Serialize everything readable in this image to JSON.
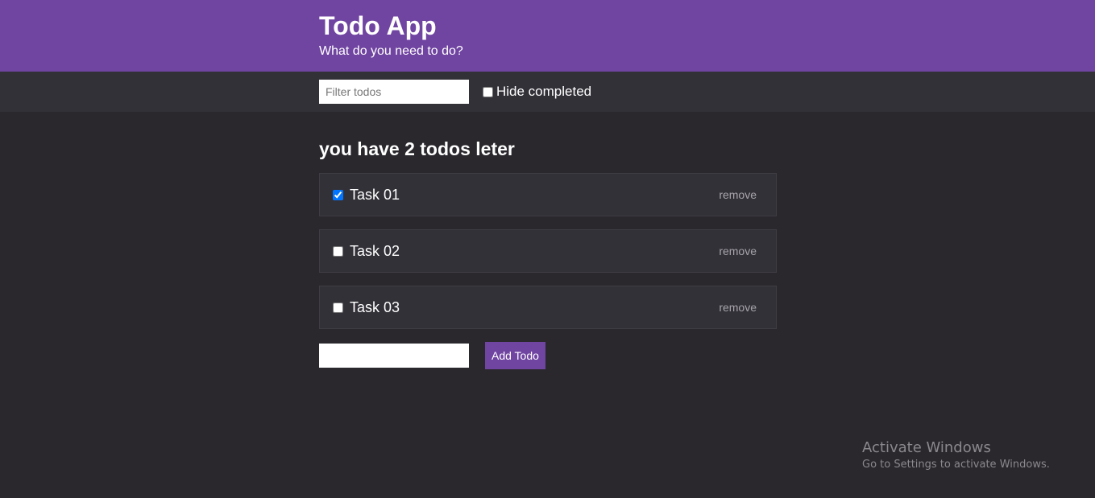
{
  "header": {
    "title": "Todo App",
    "subtitle": "What do you need to do?",
    "background_color": "#7044a1"
  },
  "filter": {
    "placeholder": "Filter todos",
    "value": "",
    "hide_completed_label": "Hide completed",
    "hide_completed_checked": false
  },
  "summary": "you have 2 todos leter",
  "todos": [
    {
      "text": "Task 01",
      "completed": true,
      "remove_label": "remove"
    },
    {
      "text": "Task 02",
      "completed": false,
      "remove_label": "remove"
    },
    {
      "text": "Task 03",
      "completed": false,
      "remove_label": "remove"
    }
  ],
  "add_form": {
    "value": "",
    "button_label": "Add Todo"
  },
  "watermark": {
    "title": "Activate Windows",
    "subtitle": "Go to Settings to activate Windows."
  }
}
